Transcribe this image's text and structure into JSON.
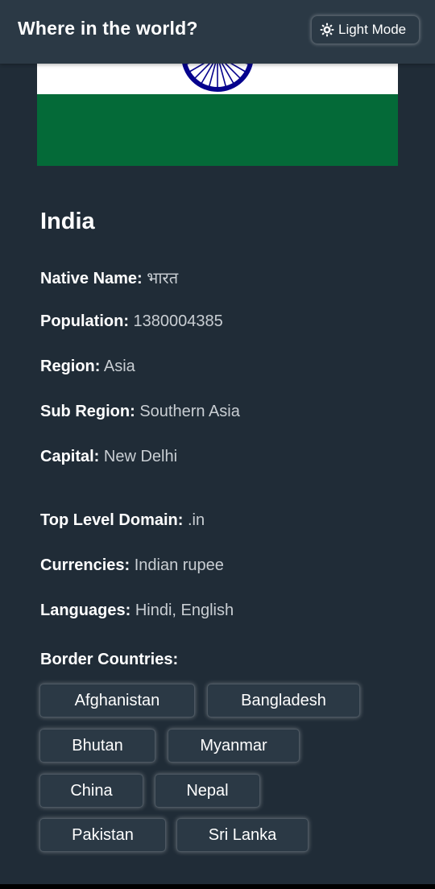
{
  "header": {
    "title": "Where in the world?",
    "mode_toggle_label": "Light Mode",
    "mode_toggle_icon": "sun-icon"
  },
  "colors": {
    "background": "#202c37",
    "elements": "#2b3945",
    "text": "#ffffff",
    "muted_text": "#c9ced3",
    "flag_saffron": "#ff9933",
    "flag_white": "#ffffff",
    "flag_green": "#046a38",
    "flag_chakra": "#06038d"
  },
  "country": {
    "name": "India",
    "details": [
      {
        "label": "Native Name:",
        "value": "भारत"
      },
      {
        "label": "Population:",
        "value": "1380004385"
      },
      {
        "label": "Region:",
        "value": "Asia"
      },
      {
        "label": "Sub Region:",
        "value": "Southern Asia"
      },
      {
        "label": "Capital:",
        "value": "New Delhi"
      },
      {
        "label": "Top Level Domain:",
        "value": ".in"
      },
      {
        "label": "Currencies:",
        "value": "Indian rupee"
      },
      {
        "label": "Languages:",
        "value": "Hindi, English"
      }
    ],
    "border_countries_title": "Border Countries:",
    "border_countries": [
      "Afghanistan",
      "Bangladesh",
      "Bhutan",
      "Myanmar",
      "China",
      "Nepal",
      "Pakistan",
      "Sri Lanka"
    ]
  }
}
